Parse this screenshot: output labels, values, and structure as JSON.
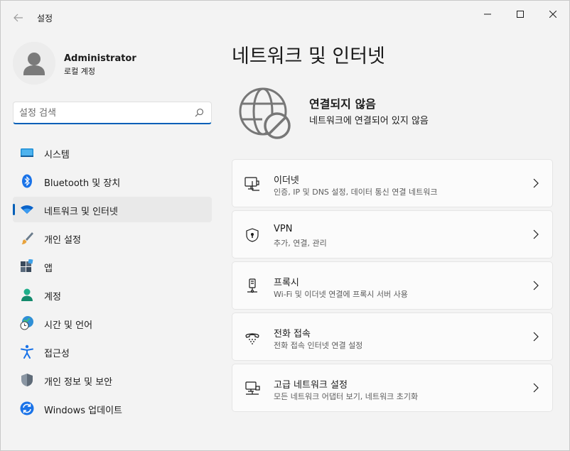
{
  "window": {
    "title": "설정"
  },
  "profile": {
    "name": "Administrator",
    "account_type": "로컬 계정"
  },
  "search": {
    "placeholder": "설정 검색",
    "value": ""
  },
  "nav": {
    "items": [
      {
        "label": "시스템",
        "icon": "system-icon"
      },
      {
        "label": "Bluetooth 및 장치",
        "icon": "bluetooth-icon"
      },
      {
        "label": "네트워크 및 인터넷",
        "icon": "wifi-icon",
        "active": true
      },
      {
        "label": "개인 설정",
        "icon": "brush-icon"
      },
      {
        "label": "앱",
        "icon": "apps-icon"
      },
      {
        "label": "계정",
        "icon": "account-icon"
      },
      {
        "label": "시간 및 언어",
        "icon": "clock-globe-icon"
      },
      {
        "label": "접근성",
        "icon": "accessibility-icon"
      },
      {
        "label": "개인 정보 및 보안",
        "icon": "shield-icon"
      },
      {
        "label": "Windows 업데이트",
        "icon": "update-icon"
      }
    ]
  },
  "main": {
    "title": "네트워크 및 인터넷",
    "status": {
      "title": "연결되지 않음",
      "subtitle": "네트워크에 연결되어 있지 않음",
      "icon": "globe-blocked-icon"
    },
    "cards": [
      {
        "title": "이더넷",
        "subtitle": "인증, IP 및 DNS 설정, 데이터 통신 연결 네트워크",
        "icon": "ethernet-icon"
      },
      {
        "title": "VPN",
        "subtitle": "추가, 연결, 관리",
        "icon": "vpn-shield-icon"
      },
      {
        "title": "프록시",
        "subtitle": "Wi-Fi 및 이더넷 연결에 프록시 서버 사용",
        "icon": "proxy-icon"
      },
      {
        "title": "전화 접속",
        "subtitle": "전화 접속 인터넷 연결 설정",
        "icon": "dialup-icon"
      },
      {
        "title": "고급 네트워크 설정",
        "subtitle": "모든 네트워크 어댑터 보기, 네트워크 초기화",
        "icon": "advanced-network-icon"
      }
    ]
  },
  "colors": {
    "accent": "#005fb8",
    "background": "#f3f3f3",
    "card": "#fbfbfb"
  }
}
